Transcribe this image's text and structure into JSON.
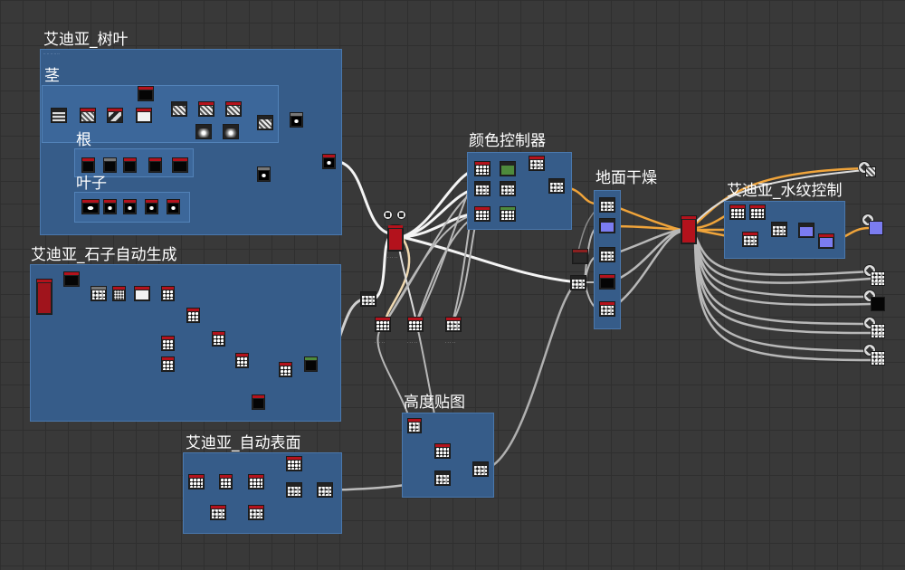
{
  "graph": {
    "frames": {
      "foliage": {
        "title": "艾迪亚_树叶",
        "subtitle": "·· ·· ·· ·· ··"
      },
      "stem": {
        "title": "茎"
      },
      "root": {
        "title": "根"
      },
      "leaf": {
        "title": "叶子"
      },
      "stones": {
        "title": "艾迪亚_石子自动生成"
      },
      "surface": {
        "title": "艾迪亚_自动表面"
      },
      "height": {
        "title": "高度贴图"
      },
      "color": {
        "title": "颜色控制器"
      },
      "dry": {
        "title": "地面干燥"
      },
      "ripple": {
        "title": "艾迪亚_水纹控制"
      }
    },
    "node_labels": {
      "merge_a": "· · · · ·",
      "merge_b": "· · · · ·",
      "merge_c": "· · · · ·",
      "main_blend": "· · · · ·"
    }
  },
  "colors": {
    "background": "#393939",
    "frame_fill": "#365c89",
    "node_cap": "#b3121c",
    "link_white": "#f4f4f4",
    "link_gray": "#9e9e9e",
    "link_orange": "#f0a43a"
  }
}
